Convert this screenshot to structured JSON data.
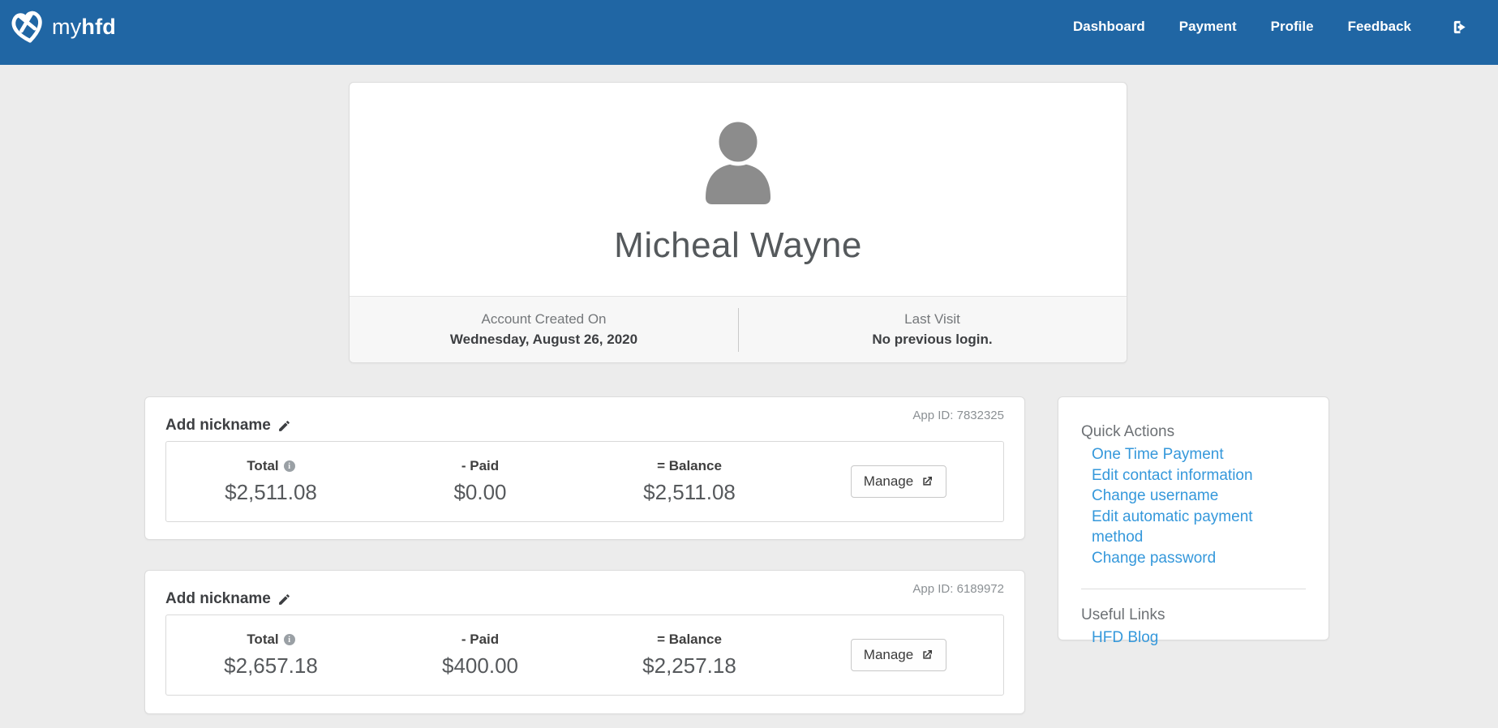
{
  "colors": {
    "navbar_bg": "#2066a4",
    "link_blue": "#3598db",
    "page_bg": "#ececec",
    "avatar_gray": "#8c8c8c"
  },
  "navbar": {
    "brand_light": "my",
    "brand_bold": "hfd",
    "items": [
      "Dashboard",
      "Payment",
      "Profile",
      "Feedback"
    ],
    "signout_icon": "sign-out-icon"
  },
  "profile": {
    "name": "Micheal Wayne",
    "created_label": "Account Created On",
    "created_value": "Wednesday, August 26, 2020",
    "last_visit_label": "Last Visit",
    "last_visit_value": "No previous login."
  },
  "accounts": [
    {
      "nickname_label": "Add nickname",
      "app_id": "App ID: 7832325",
      "total_label": "Total",
      "paid_label": "- Paid",
      "balance_label": "= Balance",
      "total": "$2,511.08",
      "paid": "$0.00",
      "balance": "$2,511.08",
      "manage_label": "Manage"
    },
    {
      "nickname_label": "Add nickname",
      "app_id": "App ID: 6189972",
      "total_label": "Total",
      "paid_label": "- Paid",
      "balance_label": "= Balance",
      "total": "$2,657.18",
      "paid": "$400.00",
      "balance": "$2,257.18",
      "manage_label": "Manage"
    }
  ],
  "sidebar": {
    "quick_actions_title": "Quick Actions",
    "quick_actions": [
      "One Time Payment",
      "Edit contact information",
      "Change username",
      "Edit automatic payment method",
      "Change password"
    ],
    "useful_links_title": "Useful Links",
    "useful_links": [
      "HFD Blog"
    ]
  }
}
